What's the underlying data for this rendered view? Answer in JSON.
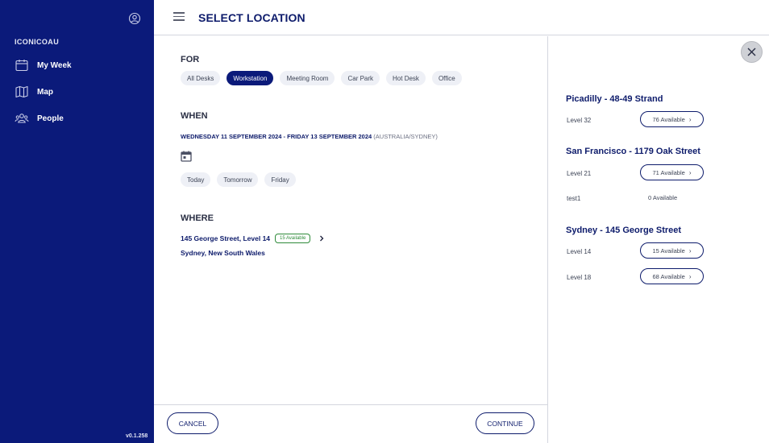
{
  "sidebar": {
    "org": "ICONICOAU",
    "items": [
      {
        "label": "My Week",
        "icon": "calendar-icon"
      },
      {
        "label": "Map",
        "icon": "map-icon"
      },
      {
        "label": "People",
        "icon": "people-icon"
      }
    ],
    "version": "v0.1.258"
  },
  "header": {
    "title": "SELECT LOCATION"
  },
  "for_section": {
    "title": "FOR",
    "chips": [
      "All Desks",
      "Workstation",
      "Meeting Room",
      "Car Park",
      "Hot Desk",
      "Office"
    ],
    "selected": "Workstation"
  },
  "when_section": {
    "title": "WHEN",
    "date_range": "WEDNESDAY 11 SEPTEMBER 2024 - FRIDAY 13 SEPTEMBER 2024",
    "timezone": "(AUSTRALIA/SYDNEY)",
    "quick": [
      "Today",
      "Tomorrow",
      "Friday"
    ]
  },
  "where_section": {
    "title": "WHERE",
    "line1": "145 George Street, Level 14",
    "badge": "15 Available",
    "line2": "Sydney, New South Wales"
  },
  "footer": {
    "cancel": "CANCEL",
    "continue": "CONTINUE"
  },
  "locations": [
    {
      "name": "Picadilly - 48-49 Strand",
      "levels": [
        {
          "level": "Level 32",
          "available": "76 Available",
          "button": true
        }
      ]
    },
    {
      "name": "San Francisco - 1179 Oak Street",
      "levels": [
        {
          "level": "Level 21",
          "available": "71 Available",
          "button": true
        },
        {
          "level": "test1",
          "available": "0 Available",
          "button": false
        }
      ]
    },
    {
      "name": "Sydney - 145 George Street",
      "levels": [
        {
          "level": "Level 14",
          "available": "15 Available",
          "button": true
        },
        {
          "level": "Level 18",
          "available": "68 Available",
          "button": true
        }
      ]
    }
  ],
  "colors": {
    "sidebar": "#0b1a7a",
    "accent": "#0d1b6b",
    "available_badge": "#2e8b3a"
  }
}
